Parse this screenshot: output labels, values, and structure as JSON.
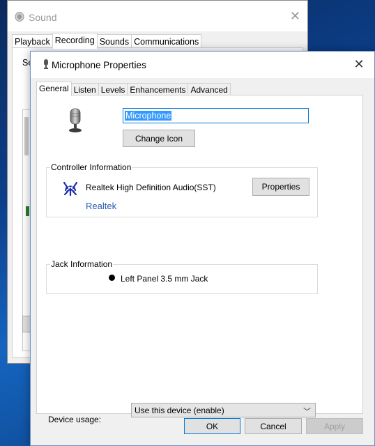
{
  "sound_window": {
    "title": "Sound",
    "tabs": [
      "Playback",
      "Recording",
      "Sounds",
      "Communications"
    ],
    "active_tab": "Recording",
    "partial_text": "Se"
  },
  "dialog": {
    "title": "Microphone Properties",
    "tabs": [
      "General",
      "Listen",
      "Levels",
      "Enhancements",
      "Advanced"
    ],
    "active_tab": "General",
    "device_name": "Microphone",
    "change_icon_label": "Change Icon",
    "controller": {
      "group_label": "Controller Information",
      "name": "Realtek High Definition Audio(SST)",
      "vendor_link": "Realtek",
      "properties_label": "Properties"
    },
    "jack": {
      "group_label": "Jack Information",
      "text": "Left Panel 3.5 mm Jack"
    },
    "device_usage": {
      "label": "Device usage:",
      "selected": "Use this device (enable)"
    },
    "buttons": {
      "ok": "OK",
      "cancel": "Cancel",
      "apply": "Apply"
    }
  },
  "colors": {
    "link": "#2a5db0",
    "selection": "#3399ff",
    "focus_border": "#0078d7"
  }
}
